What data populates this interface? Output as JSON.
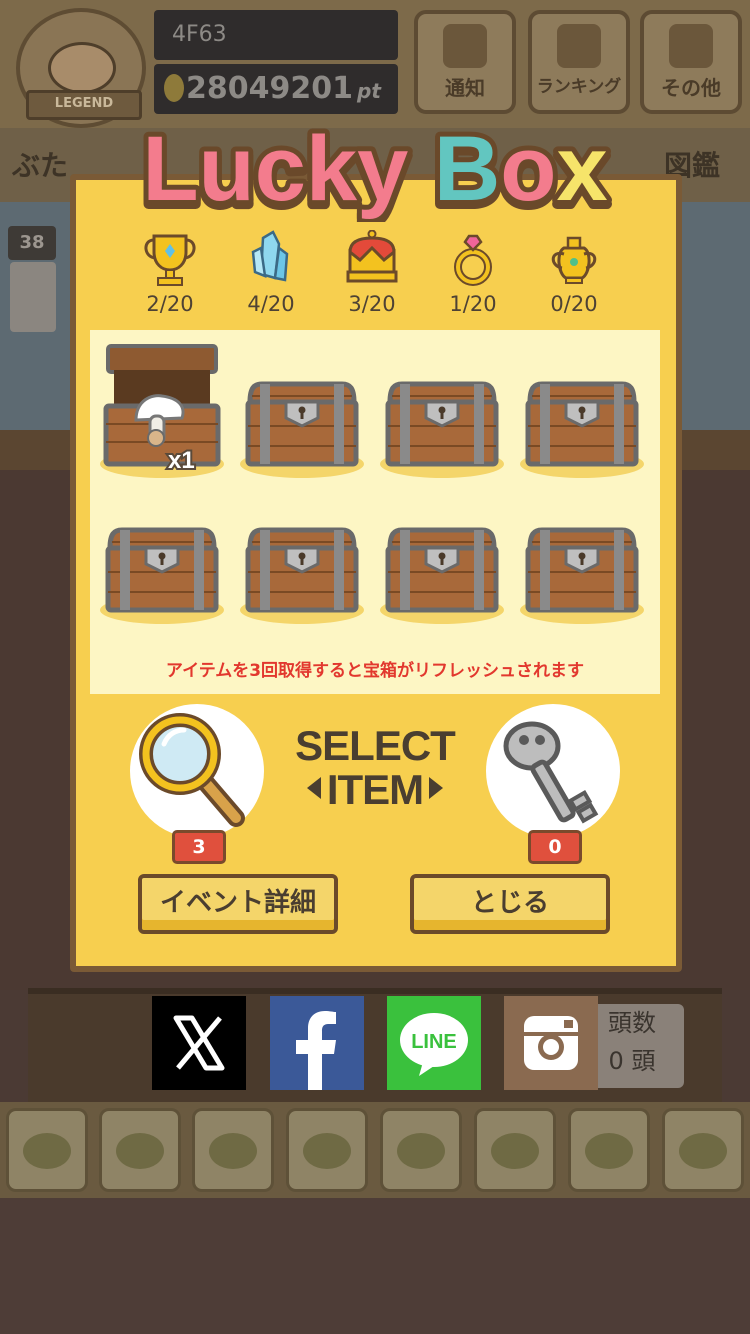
{
  "header": {
    "legend_label": "LEGEND",
    "user_id": "4F63",
    "points": "28049201",
    "points_unit": "pt",
    "buttons": [
      {
        "label": "通知",
        "icon": "bell-icon"
      },
      {
        "label": "ランキング",
        "icon": "crown-icon"
      },
      {
        "label": "その他",
        "icon": "gear-icon"
      }
    ]
  },
  "menubar": {
    "left_label": "ぶた",
    "right_label": "図鑑"
  },
  "scene": {
    "level": "38",
    "headcount_label": "頭数",
    "headcount_value": "0 頭"
  },
  "modal": {
    "title": "Lucky Box",
    "collectibles": [
      {
        "icon": "trophy-icon",
        "count": "2/20"
      },
      {
        "icon": "crystal-icon",
        "count": "4/20"
      },
      {
        "icon": "crown-icon",
        "count": "3/20"
      },
      {
        "icon": "ring-icon",
        "count": "1/20"
      },
      {
        "icon": "teapot-icon",
        "count": "0/20"
      }
    ],
    "chests": [
      {
        "state": "open",
        "reward": "mushroom",
        "qty": "x1"
      },
      {
        "state": "closed"
      },
      {
        "state": "closed"
      },
      {
        "state": "closed"
      },
      {
        "state": "closed"
      },
      {
        "state": "closed"
      },
      {
        "state": "closed"
      },
      {
        "state": "closed"
      }
    ],
    "refresh_notice": "アイテムを3回取得すると宝箱がリフレッシュされます",
    "select_line1": "SELECT",
    "select_line2": "ITEM",
    "magnifier_count": "3",
    "key_count": "0",
    "event_button": "イベント詳細",
    "close_button": "とじる"
  },
  "social": [
    {
      "icon": "x-icon",
      "color": "#000000"
    },
    {
      "icon": "facebook-icon",
      "color": "#3b5998"
    },
    {
      "icon": "line-icon",
      "color": "#3ac13d",
      "label": "LINE"
    },
    {
      "icon": "instagram-icon",
      "color": "#8a6a50"
    }
  ],
  "colors": {
    "modal_bg": "#f7cf4f",
    "modal_border": "#7a5a36",
    "notice_red": "#e2382e",
    "badge_red": "#e0503d"
  }
}
